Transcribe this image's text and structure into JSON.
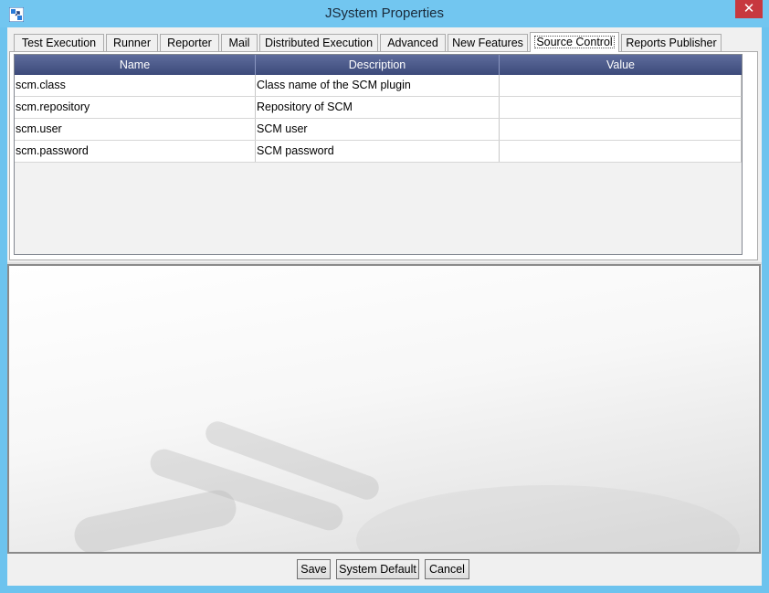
{
  "window": {
    "title": "JSystem Properties",
    "close_label": "✕"
  },
  "tabs": [
    {
      "label": "Test Execution",
      "active": false
    },
    {
      "label": "Runner",
      "active": false
    },
    {
      "label": "Reporter",
      "active": false
    },
    {
      "label": "Mail",
      "active": false
    },
    {
      "label": "Distributed Execution",
      "active": false
    },
    {
      "label": "Advanced",
      "active": false
    },
    {
      "label": "New Features",
      "active": false
    },
    {
      "label": "Source Control",
      "active": true
    },
    {
      "label": "Reports Publisher",
      "active": false
    }
  ],
  "table": {
    "columns": [
      "Name",
      "Description",
      "Value"
    ],
    "rows": [
      {
        "name": "scm.class",
        "description": "Class name of the SCM plugin",
        "value": ""
      },
      {
        "name": "scm.repository",
        "description": "Repository of SCM",
        "value": ""
      },
      {
        "name": "scm.user",
        "description": "SCM user",
        "value": ""
      },
      {
        "name": "scm.password",
        "description": "SCM password",
        "value": ""
      }
    ]
  },
  "buttons": {
    "save": "Save",
    "system_default": "System Default",
    "cancel": "Cancel"
  },
  "colors": {
    "title_bar": "#72c6f0",
    "header": "#4a5888",
    "close": "#c7383f"
  }
}
